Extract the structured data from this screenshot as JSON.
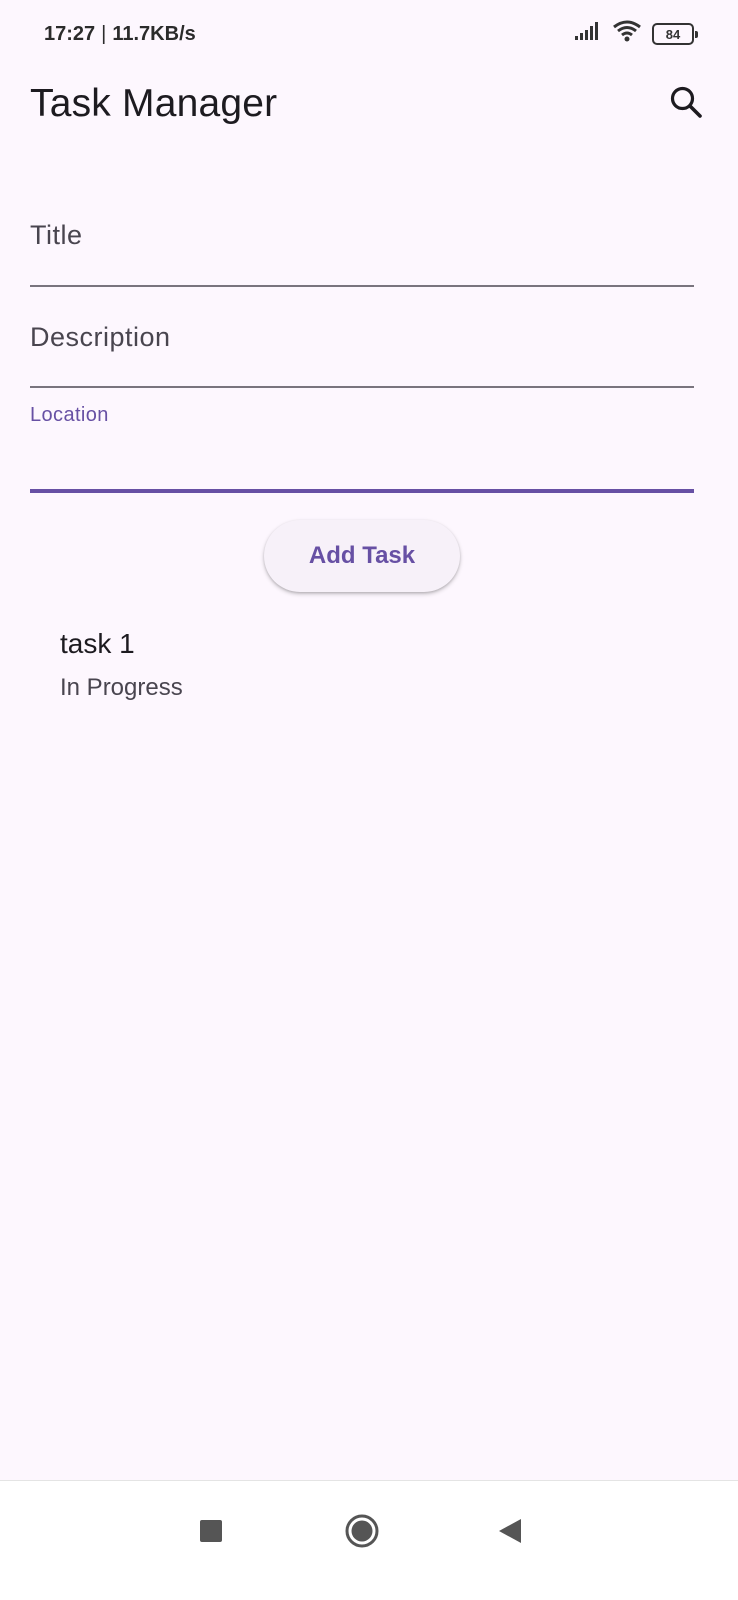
{
  "status_bar": {
    "time": "17:27",
    "separator": "|",
    "net_speed": "11.7KB/s",
    "battery": "84",
    "icons": [
      "signal-icon",
      "wifi-icon",
      "battery-icon"
    ]
  },
  "app_bar": {
    "title": "Task Manager",
    "search_icon": "search-icon"
  },
  "form": {
    "title_label": "Title",
    "title_value": "",
    "description_label": "Description",
    "description_value": "",
    "location_label": "Location",
    "location_value": "",
    "add_button": "Add Task"
  },
  "tasks": [
    {
      "title": "task 1",
      "status": "In Progress"
    }
  ],
  "nav_bar": {
    "icons": [
      "recents-icon",
      "home-icon",
      "back-icon"
    ]
  },
  "colors": {
    "background": "#fdf7fe",
    "primary": "#6750a4",
    "on_surface_variant": "#49454f"
  }
}
